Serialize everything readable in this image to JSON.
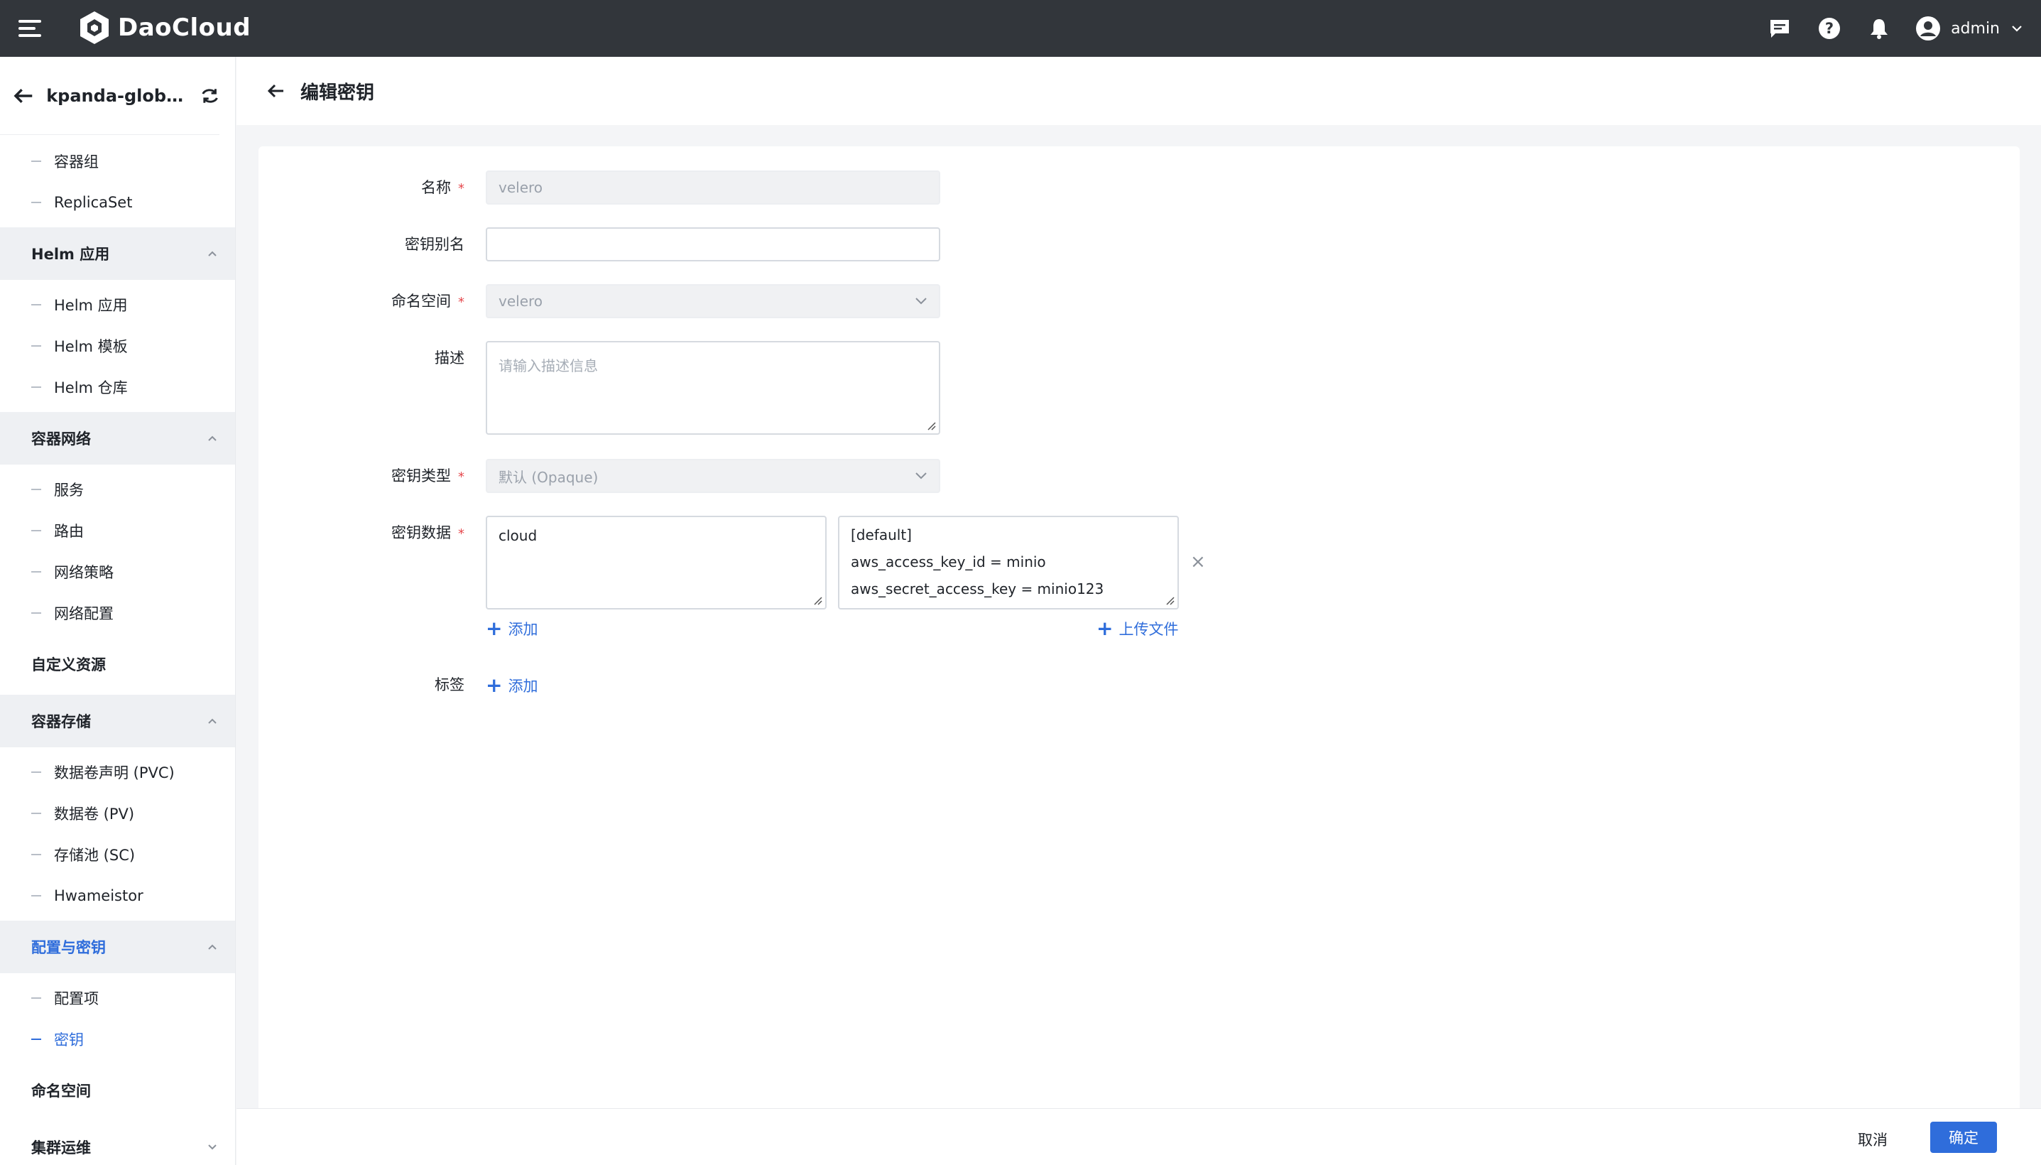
{
  "topbar": {
    "brand": "DaoCloud",
    "user": "admin"
  },
  "sidebar": {
    "cluster_name": "kpanda-global-cl...",
    "items": [
      {
        "type": "sub",
        "label": "容器组"
      },
      {
        "type": "sub",
        "label": "ReplicaSet"
      },
      {
        "type": "group",
        "label": "Helm 应用",
        "expanded": true
      },
      {
        "type": "sub",
        "label": "Helm 应用"
      },
      {
        "type": "sub",
        "label": "Helm 模板"
      },
      {
        "type": "sub",
        "label": "Helm 仓库"
      },
      {
        "type": "group",
        "label": "容器网络",
        "expanded": true
      },
      {
        "type": "sub",
        "label": "服务"
      },
      {
        "type": "sub",
        "label": "路由"
      },
      {
        "type": "sub",
        "label": "网络策略"
      },
      {
        "type": "sub",
        "label": "网络配置"
      },
      {
        "type": "plain",
        "label": "自定义资源"
      },
      {
        "type": "group",
        "label": "容器存储",
        "expanded": true
      },
      {
        "type": "sub",
        "label": "数据卷声明 (PVC)"
      },
      {
        "type": "sub",
        "label": "数据卷 (PV)"
      },
      {
        "type": "sub",
        "label": "存储池 (SC)"
      },
      {
        "type": "sub",
        "label": "Hwameistor"
      },
      {
        "type": "group",
        "label": "配置与密钥",
        "expanded": true,
        "active": true
      },
      {
        "type": "sub",
        "label": "配置项"
      },
      {
        "type": "sub",
        "label": "密钥",
        "active": true
      },
      {
        "type": "plain",
        "label": "命名空间"
      },
      {
        "type": "group-collapsed",
        "label": "集群运维"
      }
    ]
  },
  "page": {
    "title": "编辑密钥"
  },
  "form": {
    "name_label": "名称",
    "name_value": "velero",
    "alias_label": "密钥别名",
    "alias_value": "",
    "namespace_label": "命名空间",
    "namespace_value": "velero",
    "desc_label": "描述",
    "desc_placeholder": "请输入描述信息",
    "type_label": "密钥类型",
    "type_value": "默认 (Opaque)",
    "data_label": "密钥数据",
    "data_key": "cloud",
    "data_value_lines": [
      "[default]",
      "aws_access_key_id = minio",
      "aws_secret_access_key = minio123"
    ],
    "add_label": "添加",
    "upload_label": "上传文件",
    "tags_label": "标签",
    "tags_add_label": "添加",
    "required_mark": "*"
  },
  "footer": {
    "cancel": "取消",
    "confirm": "确定"
  },
  "colors": {
    "topbar": "#32363b",
    "accent": "#2f6ddb",
    "required": "#e5484d"
  }
}
